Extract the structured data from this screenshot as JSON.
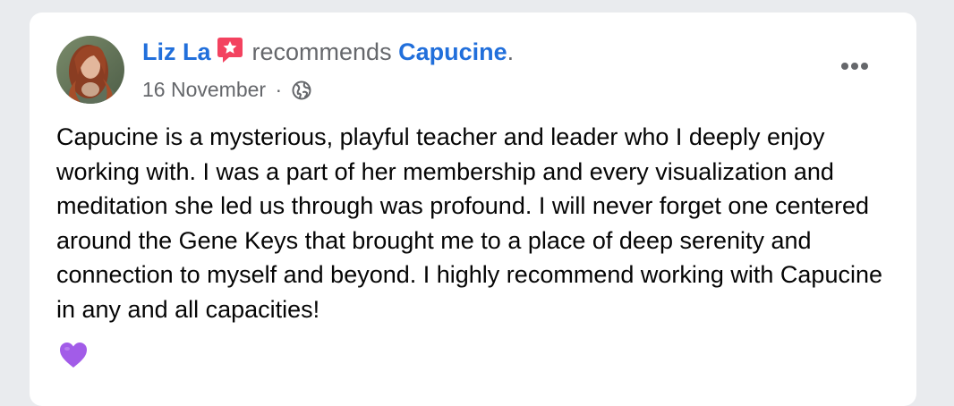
{
  "post": {
    "author": {
      "name": "Liz La",
      "avatar_icon": "profile-photo",
      "badge_icon": "recommendation-star-icon",
      "badge_color": "#f3425f"
    },
    "action_text": "recommends",
    "page_name": "Capucine",
    "trailing_punctuation": ".",
    "date": "16 November",
    "separator": "·",
    "audience_icon": "globe-icon",
    "more_icon": "more-options-icon",
    "text": "Capucine is a mysterious, playful teacher and leader who I deeply enjoy working with. I was a part of her membership and every visualization and meditation she led us through was profound. I will never forget one centered around the Gene Keys that brought me to a place of deep serenity and connection to myself and beyond. I highly recommend working with Capucine in any and all capacities!",
    "emoji": "💜",
    "emoji_icon": "purple-heart-icon",
    "colors": {
      "link": "#216fdb",
      "secondary_text": "#65676b",
      "body_text": "#050505",
      "heart": "#a25ce8",
      "background": "#e9ebee",
      "card": "#ffffff"
    }
  }
}
